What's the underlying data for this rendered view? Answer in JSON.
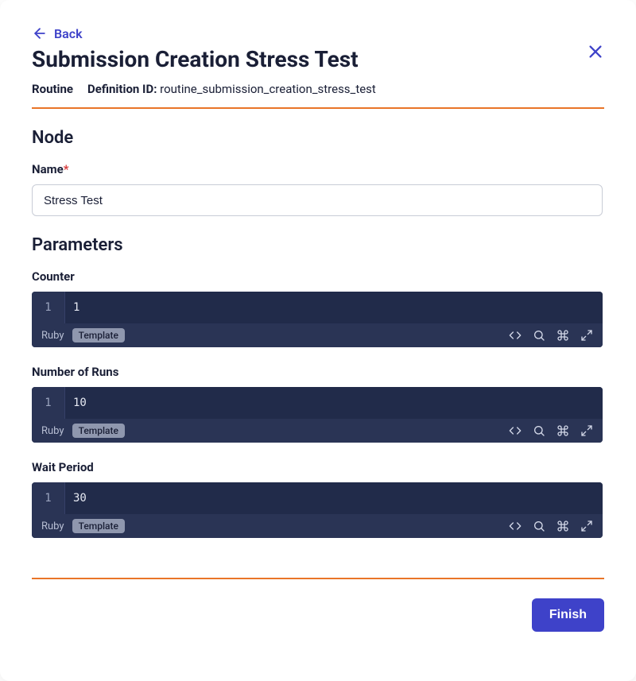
{
  "header": {
    "back_label": "Back",
    "title": "Submission Creation Stress Test",
    "routine_label": "Routine",
    "definition_id_label": "Definition ID: ",
    "definition_id_value": "routine_submission_creation_stress_test"
  },
  "node": {
    "section_heading": "Node",
    "name_label": "Name",
    "name_value": "Stress Test"
  },
  "parameters": {
    "section_heading": "Parameters",
    "items": [
      {
        "label": "Counter",
        "line_number": "1",
        "value": "1",
        "language": "Ruby",
        "badge": "Template"
      },
      {
        "label": "Number of Runs",
        "line_number": "1",
        "value": "10",
        "language": "Ruby",
        "badge": "Template"
      },
      {
        "label": "Wait Period",
        "line_number": "1",
        "value": "30",
        "language": "Ruby",
        "badge": "Template"
      }
    ]
  },
  "footer": {
    "finish_label": "Finish"
  }
}
